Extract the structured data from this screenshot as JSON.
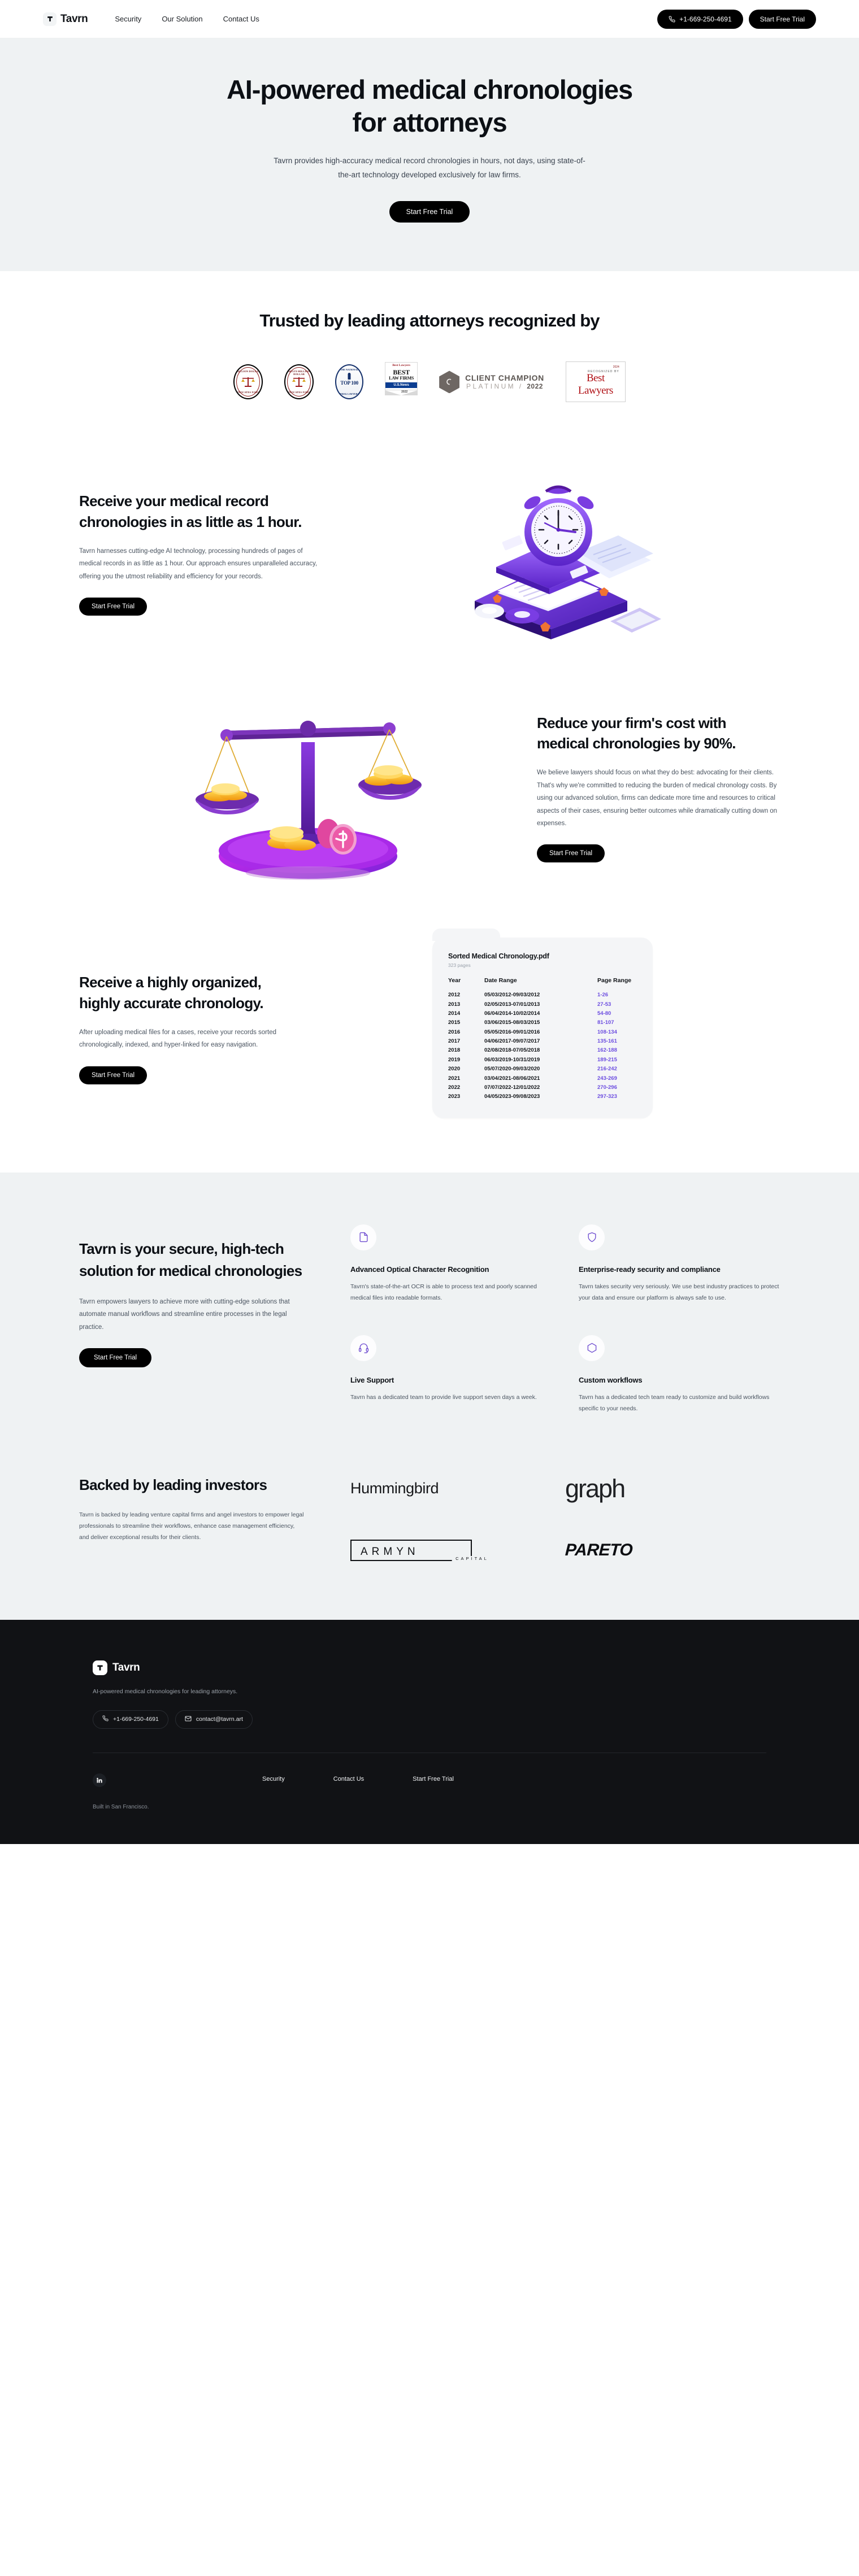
{
  "nav": {
    "brand": "Tavrn",
    "links": [
      {
        "label": "Security"
      },
      {
        "label": "Our Solution"
      },
      {
        "label": "Contact Us"
      }
    ],
    "phone": "+1-669-250-4691",
    "cta": "Start Free Trial"
  },
  "hero": {
    "heading": "AI-powered medical chronologies for attorneys",
    "subheading": "Tavrn provides high-accuracy medical record chronologies in hours, not days, using state-of-the-art technology developed exclusively for law firms.",
    "cta": "Start Free Trial"
  },
  "trusted": {
    "heading": "Trusted by leading attorneys recognized by",
    "badges": [
      {
        "name": "million-dollar-advocates-forum",
        "top": "MILLION DOLLAR",
        "bottom": "ADVOCATES FORUM"
      },
      {
        "name": "multi-million-dollar-advocates-forum",
        "top": "MULTI-MILLION DOLLAR",
        "bottom": "ADVOCATES FORUM"
      },
      {
        "name": "national-top-100-trial-lawyers",
        "top": "THE NATIONAL",
        "mid": "TOP 100",
        "bottom": "TRIAL LAWYERS"
      },
      {
        "name": "us-news-best-law-firms",
        "kicker": "Best Lawyers",
        "line1": "BEST",
        "line2": "LAW FIRMS",
        "news": "U.S.News",
        "year": "2022"
      },
      {
        "name": "client-champion-platinum",
        "line1": "CLIENT CHAMPION",
        "line2": "PLATINUM /",
        "year": "2022"
      },
      {
        "name": "best-lawyers",
        "year": "2024",
        "kicker": "RECOGNIZED BY",
        "name_text": "Best Lawyers"
      }
    ]
  },
  "feature_speed": {
    "heading": "Receive your medical record chronologies in as little as 1 hour.",
    "body": "Tavrn harnesses cutting-edge AI technology, processing hundreds of pages of medical records in as little as 1 hour. Our approach ensures unparalleled accuracy, offering you the utmost reliability and efficiency for your records.",
    "cta": "Start Free Trial",
    "art": "stopwatch-on-document-stack-illustration"
  },
  "feature_cost": {
    "heading": "Reduce your firm's cost with medical chronologies by 90%.",
    "body": "We believe lawyers should focus on what they do best: advocating for their clients. That's why we're committed to reducing the burden of medical chronology costs. By using our advanced solution, firms can dedicate more time and resources to critical aspects of their cases, ensuring better outcomes while dramatically cutting down on expenses.",
    "cta": "Start Free Trial",
    "art": "balance-scale-with-gold-coins-illustration"
  },
  "feature_organized": {
    "heading": "Receive a highly organized, highly accurate chronology.",
    "body": "After uploading medical files for a cases, receive your records sorted chronologically, indexed, and hyper-linked for easy navigation.",
    "cta": "Start Free Trial"
  },
  "chronology": {
    "file_name": "Sorted Medical Chronology.pdf",
    "page_count": "323 pages",
    "columns": [
      "Year",
      "Date Range",
      "Page Range"
    ],
    "rows": [
      {
        "year": "2012",
        "date_range": "05/03/2012-09/03/2012",
        "page_range": "1-26"
      },
      {
        "year": "2013",
        "date_range": "02/05/2013-07/01/2013",
        "page_range": "27-53"
      },
      {
        "year": "2014",
        "date_range": "06/04/2014-10/02/2014",
        "page_range": "54-80"
      },
      {
        "year": "2015",
        "date_range": "03/06/2015-08/03/2015",
        "page_range": "81-107"
      },
      {
        "year": "2016",
        "date_range": "05/05/2016-09/01/2016",
        "page_range": "108-134"
      },
      {
        "year": "2017",
        "date_range": "04/06/2017-09/07/2017",
        "page_range": "135-161"
      },
      {
        "year": "2018",
        "date_range": "02/08/2018-07/05/2018",
        "page_range": "162-188"
      },
      {
        "year": "2019",
        "date_range": "06/03/2019-10/31/2019",
        "page_range": "189-215"
      },
      {
        "year": "2020",
        "date_range": "05/07/2020-09/03/2020",
        "page_range": "216-242"
      },
      {
        "year": "2021",
        "date_range": "03/04/2021-08/06/2021",
        "page_range": "243-269"
      },
      {
        "year": "2022",
        "date_range": "07/07/2022-12/01/2022",
        "page_range": "270-296"
      },
      {
        "year": "2023",
        "date_range": "04/05/2023-09/08/2023",
        "page_range": "297-323"
      }
    ],
    "link_color": "#6c4de0"
  },
  "secure": {
    "heading": "Tavrn is your secure, high-tech solution for medical chronologies",
    "body": "Tavrn empowers lawyers to achieve more with cutting-edge solutions that automate manual workflows and streamline entire processes in the legal practice.",
    "cta": "Start Free Trial",
    "cards": [
      {
        "icon": "document-icon",
        "title": "Advanced Optical Character Recognition",
        "body": "Tavrn's state-of-the-art OCR is able to process text and poorly scanned medical files into readable formats."
      },
      {
        "icon": "shield-icon",
        "title": "Enterprise-ready security and compliance",
        "body": "Tavrn takes security very seriously. We use best industry practices to protect your data and ensure our platform is always safe to use."
      },
      {
        "icon": "headset-icon",
        "title": "Live Support",
        "body": "Tavrn has a dedicated team to provide live support seven days a week."
      },
      {
        "icon": "hexagon-icon",
        "title": "Custom workflows",
        "body": "Tavrn has a dedicated tech team ready to customize and build workflows specific to your needs."
      }
    ]
  },
  "investors": {
    "heading": "Backed by leading investors",
    "body": "Tavrn is backed by leading venture capital firms and angel investors to empower legal professionals to streamline their workflows, enhance case management efficiency, and deliver exceptional results for their clients.",
    "logos": [
      {
        "name": "hummingbird",
        "text": "Hummingbird"
      },
      {
        "name": "graph",
        "text": "graph"
      },
      {
        "name": "armyn-capital",
        "text": "ARMYN",
        "sub": "CAPITAL"
      },
      {
        "name": "pareto",
        "text": "PARETO"
      }
    ]
  },
  "footer": {
    "brand": "Tavrn",
    "tagline": "AI-powered medical chronologies for leading attorneys.",
    "phone": "+1-669-250-4691",
    "email": "contact@tavrn.art",
    "social": "linkedin-icon",
    "built": "Built in San Francisco.",
    "links": [
      {
        "label": "Security"
      },
      {
        "label": "Contact Us"
      },
      {
        "label": "Start Free Trial"
      }
    ]
  },
  "colors": {
    "accent_purple": "#6c4de0",
    "hero_bg": "#eff2f3",
    "footer_bg": "#111215",
    "dark_button": "#000000"
  }
}
